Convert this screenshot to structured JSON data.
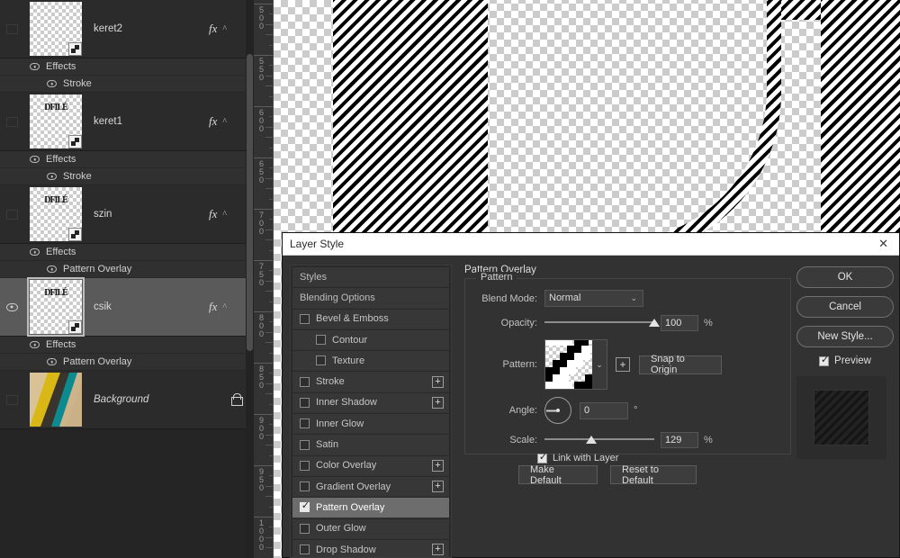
{
  "layers_panel": {
    "layers": [
      {
        "name": "keret2",
        "visible": false,
        "selected": false,
        "thumb_text": "",
        "fx": "fx",
        "caret": "^",
        "effects_label": "Effects",
        "effect_items": [
          "Stroke"
        ]
      },
      {
        "name": "keret1",
        "visible": false,
        "selected": false,
        "thumb_text": "DFILÉ",
        "fx": "fx",
        "caret": "^",
        "effects_label": "Effects",
        "effect_items": [
          "Stroke"
        ]
      },
      {
        "name": "szin",
        "visible": false,
        "selected": false,
        "thumb_text": "DFILÉ",
        "fx": "fx",
        "caret": "^",
        "effects_label": "Effects",
        "effect_items": [
          "Pattern Overlay"
        ]
      },
      {
        "name": "csik",
        "visible": true,
        "selected": true,
        "thumb_text": "DFILÉ",
        "fx": "fx",
        "caret": "^",
        "effects_label": "Effects",
        "effect_items": [
          "Pattern Overlay"
        ]
      },
      {
        "name": "Background",
        "visible": false,
        "selected": false,
        "thumb_text": "",
        "locked": true,
        "italic": true
      }
    ]
  },
  "ruler": {
    "unit_labels": [
      "500",
      "550",
      "600",
      "650",
      "700",
      "750",
      "800",
      "850",
      "900",
      "950",
      "1000"
    ],
    "orientation": "vertical"
  },
  "dialog": {
    "title": "Layer Style",
    "close_label": "✕",
    "styles_list": [
      {
        "label": "Styles",
        "type": "section",
        "checkbox": false,
        "plus": false,
        "indent": 0
      },
      {
        "label": "Blending Options",
        "type": "section",
        "checkbox": false,
        "plus": false,
        "indent": 0
      },
      {
        "label": "Bevel & Emboss",
        "type": "item",
        "checkbox": true,
        "checked": false,
        "plus": false,
        "indent": 0
      },
      {
        "label": "Contour",
        "type": "item",
        "checkbox": true,
        "checked": false,
        "plus": false,
        "indent": 1
      },
      {
        "label": "Texture",
        "type": "item",
        "checkbox": true,
        "checked": false,
        "plus": false,
        "indent": 1
      },
      {
        "label": "Stroke",
        "type": "item",
        "checkbox": true,
        "checked": false,
        "plus": true,
        "indent": 0
      },
      {
        "label": "Inner Shadow",
        "type": "item",
        "checkbox": true,
        "checked": false,
        "plus": true,
        "indent": 0
      },
      {
        "label": "Inner Glow",
        "type": "item",
        "checkbox": true,
        "checked": false,
        "plus": false,
        "indent": 0
      },
      {
        "label": "Satin",
        "type": "item",
        "checkbox": true,
        "checked": false,
        "plus": false,
        "indent": 0
      },
      {
        "label": "Color Overlay",
        "type": "item",
        "checkbox": true,
        "checked": false,
        "plus": true,
        "indent": 0
      },
      {
        "label": "Gradient Overlay",
        "type": "item",
        "checkbox": true,
        "checked": false,
        "plus": true,
        "indent": 0
      },
      {
        "label": "Pattern Overlay",
        "type": "item",
        "checkbox": true,
        "checked": true,
        "plus": false,
        "indent": 0,
        "active": true
      },
      {
        "label": "Outer Glow",
        "type": "item",
        "checkbox": true,
        "checked": false,
        "plus": false,
        "indent": 0
      },
      {
        "label": "Drop Shadow",
        "type": "item",
        "checkbox": true,
        "checked": false,
        "plus": true,
        "indent": 0
      }
    ],
    "settings": {
      "section_title": "Pattern Overlay",
      "group_label": "Pattern",
      "blend_mode": {
        "label": "Blend Mode:",
        "value": "Normal",
        "caret": "⌄"
      },
      "opacity": {
        "label": "Opacity:",
        "value": "100",
        "unit": "%",
        "percent": 100
      },
      "pattern": {
        "label": "Pattern:",
        "caret": "⌄",
        "add_button": "+",
        "snap_button": "Snap to Origin"
      },
      "angle": {
        "label": "Angle:",
        "value": "0",
        "unit": "°",
        "degrees": 0
      },
      "scale": {
        "label": "Scale:",
        "value": "129",
        "unit": "%",
        "percent": 129
      },
      "link_with_layer": {
        "label": "Link with Layer",
        "checked": true
      },
      "make_default": "Make Default",
      "reset_to_default": "Reset to Default"
    },
    "buttons": {
      "ok": "OK",
      "cancel": "Cancel",
      "new_style": "New Style...",
      "preview": {
        "label": "Preview",
        "checked": true
      }
    }
  },
  "colors": {
    "panel_bg": "#252525",
    "dialog_bg": "#323232",
    "titlebar_bg": "#ffffff",
    "selection": "#5a5a5a",
    "active_style": "#6d6d6d",
    "text": "#d4d4d4"
  }
}
